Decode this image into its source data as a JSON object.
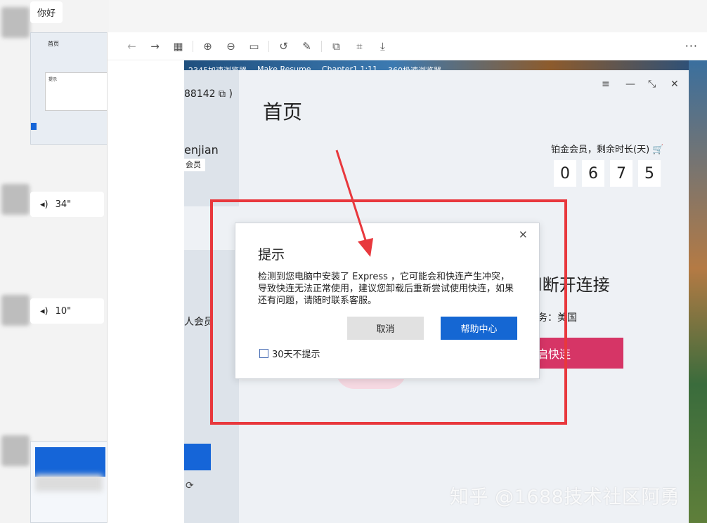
{
  "chat": {
    "greeting": "你好",
    "voice1": "34\"",
    "voice2": "10\"",
    "thumb_title": "首页",
    "thumb_dialog_title": "提示"
  },
  "viewer": {
    "more_label": "···",
    "icons": [
      "back-icon",
      "forward-icon",
      "grid-icon",
      "zoom-in-icon",
      "zoom-out-icon",
      "fit-icon",
      "rotate-icon",
      "edit-icon",
      "copy-icon",
      "scan-icon",
      "download-icon"
    ]
  },
  "desktop": {
    "icon_labels": [
      "2345加速浏览器",
      "Make Resume",
      "Chapter1 1:11",
      "360极速浏览器"
    ]
  },
  "app": {
    "account_fragment": "88142",
    "username_fragment": "enjian",
    "badge_fragment": "会员",
    "vip_fragment": "人会员",
    "title": "首页",
    "member_status": "铂金会员，剩余时长(天)",
    "days_digits": [
      "0",
      "6",
      "7",
      "5"
    ],
    "disconnect_fragment": "l断开连接",
    "region_fragment": "务：美国",
    "connect_fragment": "启快连"
  },
  "dialog": {
    "title": "提示",
    "message": "检测到您电脑中安装了 Express     ，它可能会和快连产生冲突，导致快连无法正常使用，建议您卸载后重新尝试使用快连，如果还有问题，请随时联系客服。",
    "cancel_label": "取消",
    "help_label": "帮助中心",
    "checkbox_label": "30天不提示",
    "close_label": "×"
  },
  "watermark": "知乎 @1688技术社区阿勇",
  "colors": {
    "annotation_red": "#e8383d",
    "primary_blue": "#1567d3",
    "connect_pink": "#d63566"
  }
}
